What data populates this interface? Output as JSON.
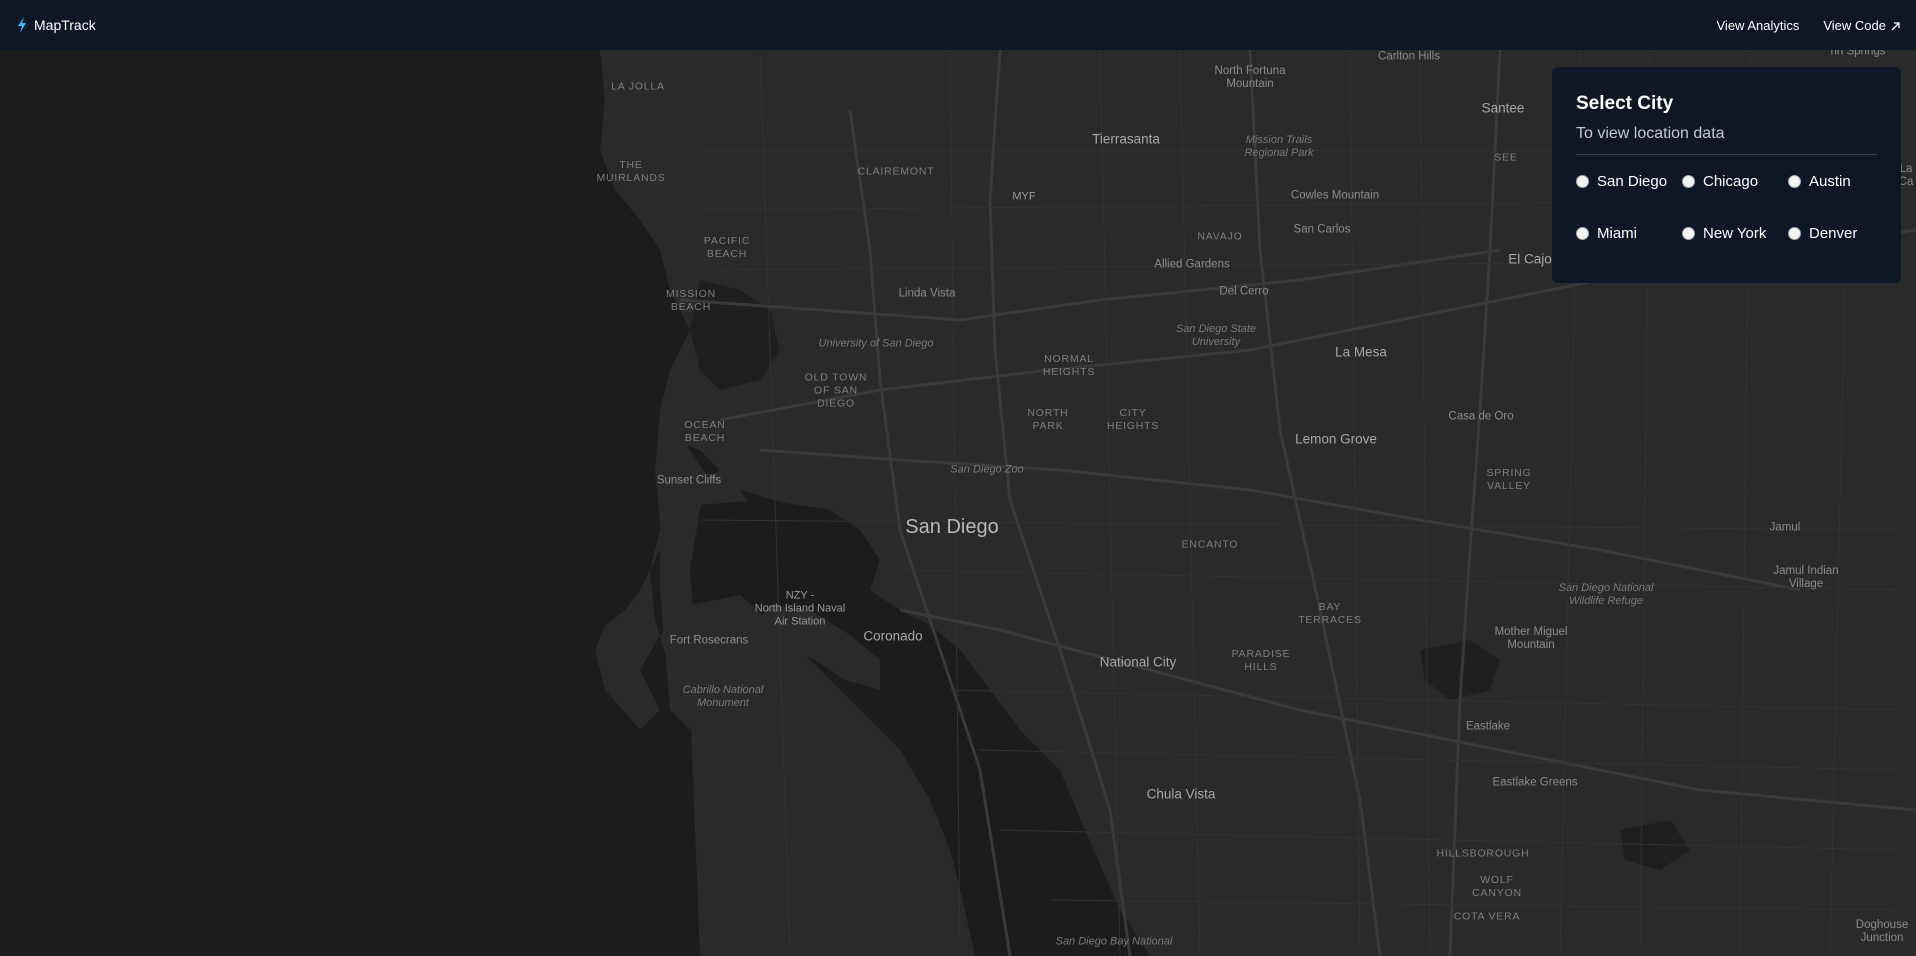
{
  "navbar": {
    "brand": "MapTrack",
    "brand_icon": "lightning-bolt-icon",
    "brand_icon_color": "#38bdf8",
    "links": [
      {
        "label": "View Analytics"
      },
      {
        "label": "View Code",
        "icon": "external-link-arrow-icon"
      }
    ]
  },
  "city_selector": {
    "title": "Select City",
    "subtitle": "To view location data",
    "options": [
      "San Diego",
      "Chicago",
      "Austin",
      "Miami",
      "New York",
      "Denver"
    ]
  },
  "map": {
    "theme": "dark",
    "land_color": "#2a2a2a",
    "water_color": "#1c1c1c",
    "labels": {
      "carlton_hills": "Carlton Hills",
      "north_fortuna": "North Fortuna\nMountain",
      "santee": "Santee",
      "la_jolla": "LA JOLLA",
      "tierrasanta": "Tierrasanta",
      "mission_trails": "Mission Trails\nRegional Park",
      "see": "SEE",
      "the_muirlands": "THE\nMUIRLANDS",
      "clairemont": "CLAIREMONT",
      "myf": "MYF",
      "cowles": "Cowles Mountain",
      "navajo": "NAVAJO",
      "san_carlos": "San Carlos",
      "pacific_beach": "PACIFIC\nBEACH",
      "allied_gardens": "Allied Gardens",
      "el_cajon": "El Cajo",
      "mission_beach": "MISSION\nBEACH",
      "linda_vista": "Linda Vista",
      "del_cerro": "Del Cerro",
      "sdsu": "San Diego State\nUniversity",
      "usd": "University of San Diego",
      "la_mesa": "La Mesa",
      "normal_heights": "NORMAL\nHEIGHTS",
      "old_town": "OLD TOWN\nOF SAN\nDIEGO",
      "north_park": "NORTH\nPARK",
      "city_heights": "CITY\nHEIGHTS",
      "casa_de_oro": "Casa de Oro",
      "ocean_beach": "OCEAN\nBEACH",
      "lemon_grove": "Lemon Grove",
      "sd_zoo": "San Diego Zoo",
      "sunset_cliffs": "Sunset Cliffs",
      "spring_valley": "SPRING\nVALLEY",
      "san_diego": "San Diego",
      "jamul": "Jamul",
      "encanto": "ENCANTO",
      "jamul_indian": "Jamul Indian\nVillage",
      "nzy": "NZY -\nNorth Island Naval\nAir Station",
      "sd_wildlife": "San Diego National\nWildlife Refuge",
      "bay_terraces": "BAY\nTERRACES",
      "fort_rosecrans": "Fort Rosecrans",
      "coronado": "Coronado",
      "mother_miguel": "Mother Miguel\nMountain",
      "paradise_hills": "PARADISE\nHILLS",
      "national_city": "National City",
      "cabrillo": "Cabrillo National\nMonument",
      "eastlake": "Eastlake",
      "eastlake_greens": "Eastlake Greens",
      "chula_vista": "Chula Vista",
      "hillsborough": "HILLSBOROUGH",
      "wolf_canyon": "WOLF\nCANYON",
      "cota_vera": "COTA VERA",
      "sd_bay_national": "San Diego Bay National",
      "dehesa": "hn Springs",
      "la_cal": "La\nCa",
      "dog_house": "Doghouse\nJunction"
    }
  }
}
